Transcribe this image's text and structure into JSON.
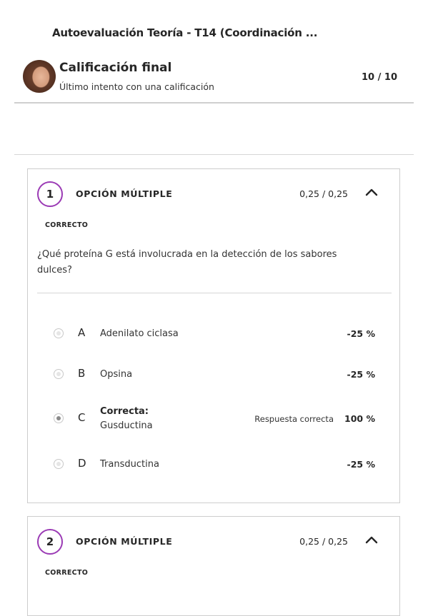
{
  "header": {
    "title": "Autoevaluación Teoría - T14 (Coordinación ...",
    "grade_title": "Calificación final",
    "grade_subtitle": "Último intento con una calificación",
    "grade_score": "10 / 10"
  },
  "questions": [
    {
      "number": "1",
      "type": "OPCIÓN MÚLTIPLE",
      "score": "0,25 / 0,25",
      "status": "CORRECTO",
      "text": "¿Qué proteína G está involucrada en la detección de los sabores dulces?",
      "options": [
        {
          "letter": "A",
          "text": "Adenilato ciclasa",
          "pct": "-25 %"
        },
        {
          "letter": "B",
          "text": "Opsina",
          "pct": "-25 %"
        },
        {
          "letter": "C",
          "label": "Correcta:",
          "text": "Gusductina",
          "answer": "Respuesta correcta",
          "pct": "100 %"
        },
        {
          "letter": "D",
          "text": "Transductina",
          "pct": "-25 %"
        }
      ]
    },
    {
      "number": "2",
      "type": "OPCIÓN MÚLTIPLE",
      "score": "0,25 / 0,25",
      "status": "CORRECTO"
    }
  ],
  "colors": {
    "accent": "#9b3bb5",
    "divider": "#cfcfcf",
    "text": "#262626"
  },
  "icons": [
    "avatar",
    "chevron-up-icon",
    "radio-icon"
  ]
}
